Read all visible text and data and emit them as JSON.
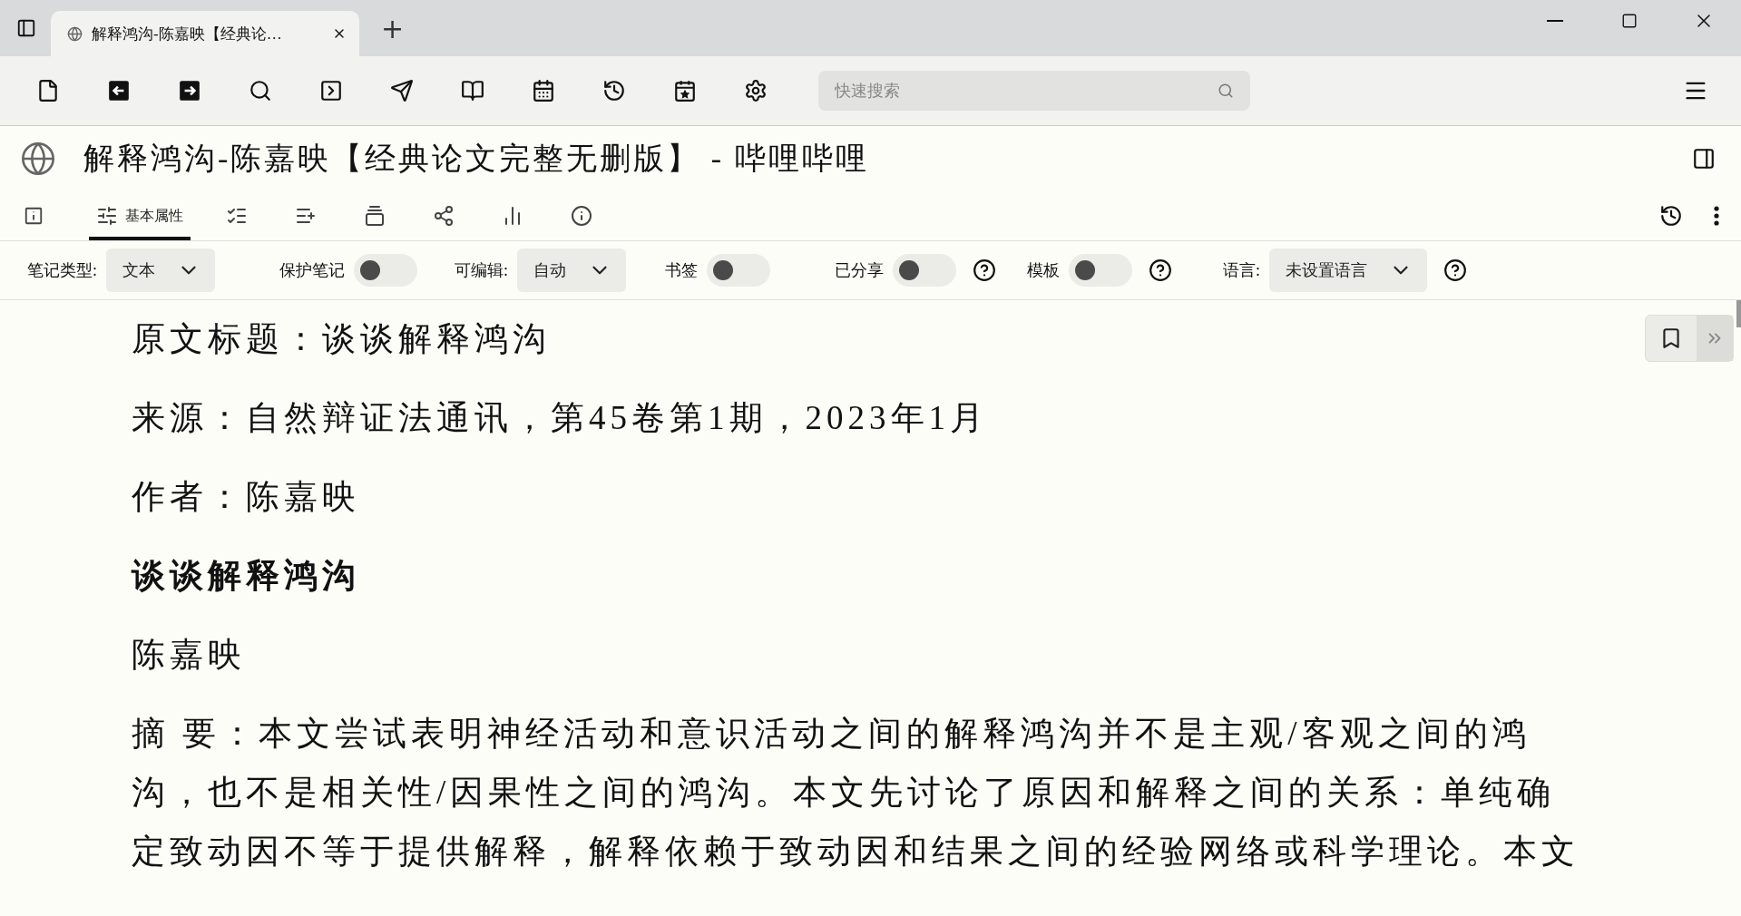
{
  "window": {
    "tabs": [
      {
        "title": "解释鸿沟-陈嘉映【经典论…",
        "selected": true
      }
    ],
    "new_tab": "+"
  },
  "toolbar": {
    "search": {
      "placeholder": "快速搜索"
    }
  },
  "note": {
    "title": "解释鸿沟-陈嘉映【经典论文完整无删版】 - 哔哩哔哩",
    "ribbon_tabs": [
      {
        "selected": false
      },
      {
        "label": "基本属性",
        "selected": true
      },
      {
        "selected": false
      },
      {
        "selected": false
      },
      {
        "selected": false
      },
      {
        "selected": false
      },
      {
        "selected": false
      },
      {
        "selected": false
      }
    ],
    "properties": [
      {
        "kind": "select",
        "label": "笔记类型:",
        "value": "文本",
        "help": false
      },
      {
        "kind": "toggle",
        "label": "保护笔记",
        "on": false,
        "help": false
      },
      {
        "kind": "select",
        "label": "可编辑:",
        "value": "自动",
        "help": false
      },
      {
        "kind": "toggle",
        "label": "书签",
        "on": false,
        "help": false
      },
      {
        "kind": "toggle",
        "label": "已分享",
        "on": false,
        "help": true
      },
      {
        "kind": "toggle",
        "label": "模板",
        "on": false,
        "help": true
      },
      {
        "kind": "select",
        "label": "语言:",
        "value": "未设置语言",
        "help": true
      }
    ],
    "content": [
      {
        "kind": "plain",
        "text": "原文标题：谈谈解释鸿沟"
      },
      {
        "kind": "plain",
        "text": "来源：自然辩证法通讯，第45卷第1期，2023年1月"
      },
      {
        "kind": "plain",
        "text": "作者：陈嘉映"
      },
      {
        "kind": "bold",
        "text": "谈谈解释鸿沟"
      },
      {
        "kind": "plain",
        "text": "陈嘉映"
      },
      {
        "kind": "plain",
        "text": "摘 要：本文尝试表明神经活动和意识活动之间的解释鸿沟并不是主观/客观之间的鸿沟，也不是相关性/因果性之间的鸿沟。本文先讨论了原因和解释之间的关系：单纯确定致动因不等于提供解释，解释依赖于致动因和结果之间的经验网络或科学理论。本文"
      }
    ]
  }
}
